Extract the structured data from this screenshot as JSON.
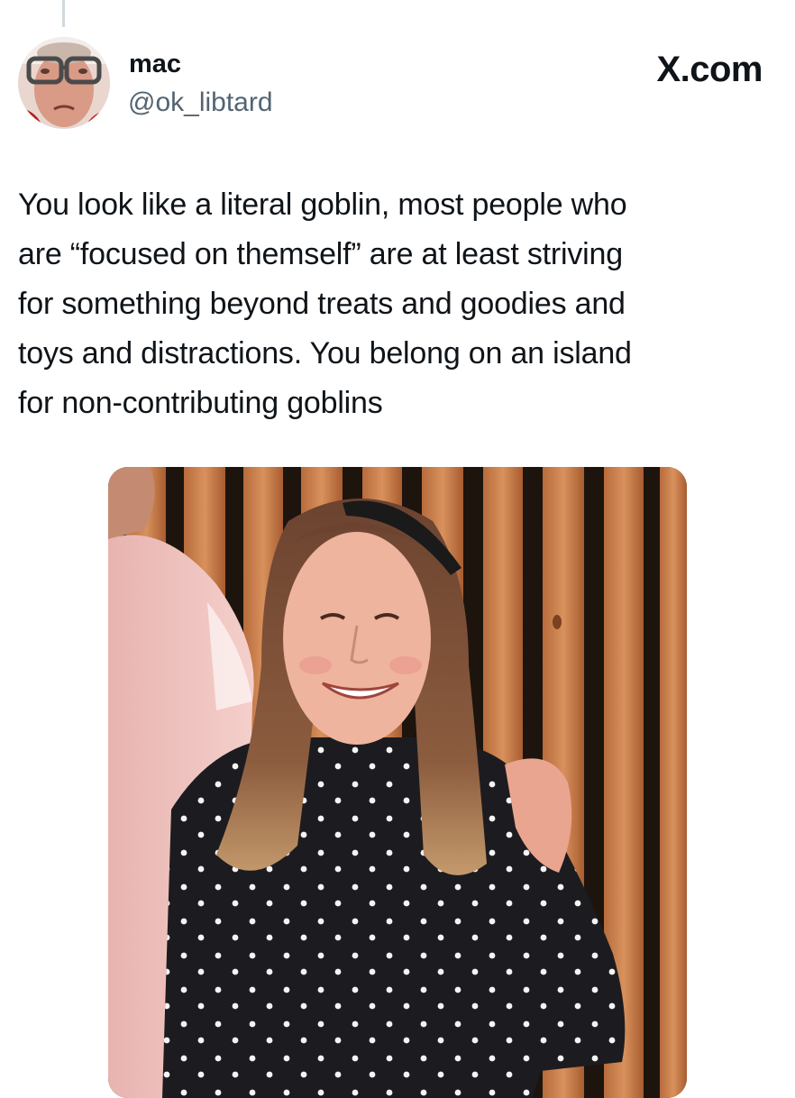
{
  "tweet": {
    "author": {
      "display_name": "mac",
      "handle": "@ok_libtard"
    },
    "brand": "X.com",
    "text_lines": [
      "You look like a literal goblin, most people who",
      "are “focused on themself” are at least striving",
      "for something beyond treats and goodies and",
      "toys and distractions. You belong on an island",
      "for non-contributing goblins"
    ]
  }
}
